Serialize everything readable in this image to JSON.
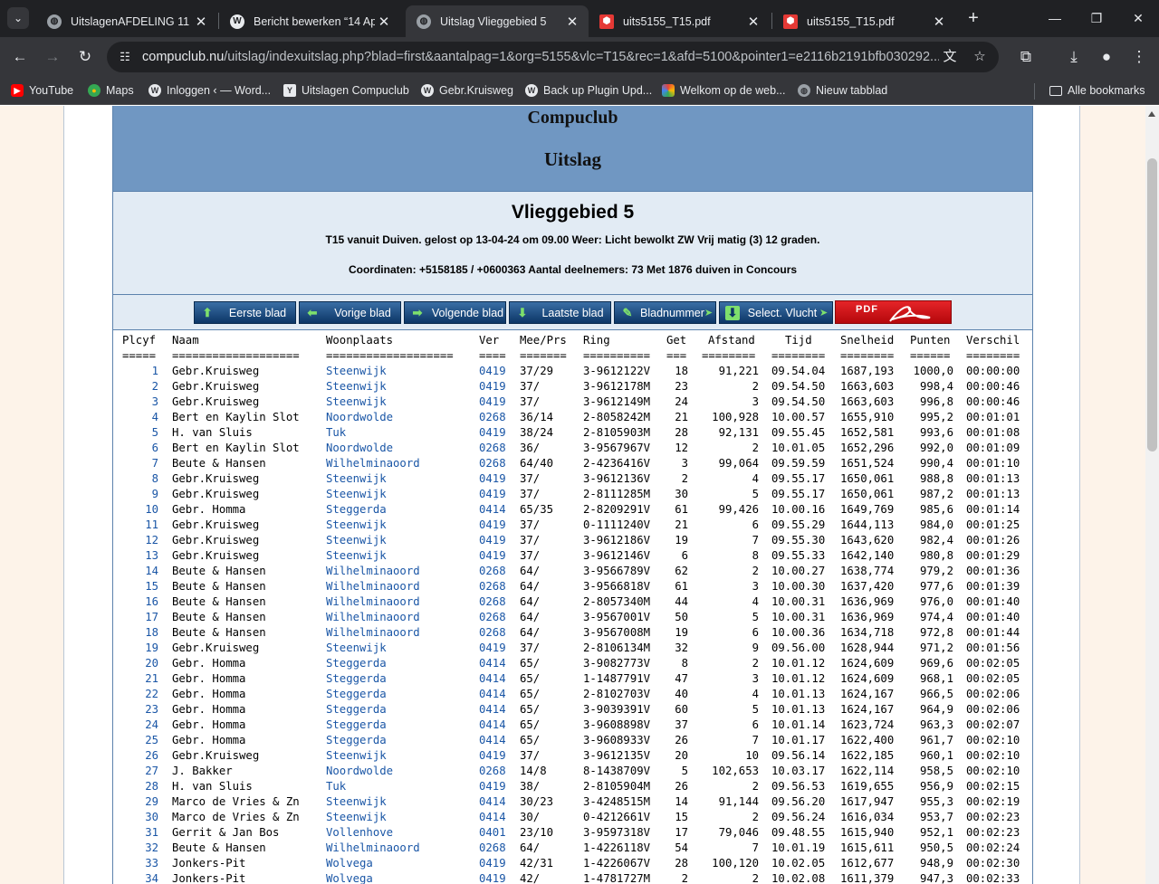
{
  "browser": {
    "tabs": [
      {
        "title": "UitslagenAFDELING 11",
        "icon": "globe-icon",
        "active": false
      },
      {
        "title": "Bericht bewerken “14 Ap",
        "icon": "wordpress-icon",
        "active": false
      },
      {
        "title": "Uitslag Vlieggebied 5",
        "icon": "globe-icon",
        "active": true
      },
      {
        "title": "uits5155_T15.pdf",
        "icon": "pdf-icon",
        "active": false
      },
      {
        "title": "uits5155_T15.pdf",
        "icon": "pdf-icon",
        "active": false
      }
    ],
    "url_host": "compuclub.nu",
    "url_rest": "/uitslag/indexuitslag.php?blad=first&aantalpag=1&org=5155&vlc=T15&rec=1&afd=5100&pointer1=e2116b2191bfb030292...",
    "bookmarks": [
      {
        "label": "YouTube",
        "icon": "youtube-icon"
      },
      {
        "label": "Maps",
        "icon": "maps-icon"
      },
      {
        "label": "Inloggen ‹ — Word...",
        "icon": "wordpress-icon"
      },
      {
        "label": "Uitslagen Compuclub",
        "icon": "compuclub-icon"
      },
      {
        "label": "Gebr.Kruisweg",
        "icon": "wordpress-icon"
      },
      {
        "label": "Back up Plugin Upd...",
        "icon": "wordpress-icon"
      },
      {
        "label": "Welkom op de web...",
        "icon": "colorful-icon"
      },
      {
        "label": "Nieuw tabblad",
        "icon": "globe-icon"
      }
    ],
    "all_bookmarks": "Alle bookmarks"
  },
  "header": {
    "club": "Compuclub",
    "title": "Uitslag"
  },
  "info": {
    "vlieggebied": "Vlieggebied 5",
    "line1": "T15 vanuit Duiven. gelost op 13-04-24 om 09.00 Weer: Licht bewolkt ZW Vrij matig (3) 12 graden.",
    "line2": "Coordinaten: +5158185 / +0600363 Aantal deelnemers: 73 Met 1876 duiven in Concours"
  },
  "nav_buttons": {
    "first": "Eerste blad",
    "prev": "Vorige blad",
    "next": "Volgende blad",
    "last": "Laatste blad",
    "page": "Bladnummer",
    "select": "Select. Vlucht",
    "pdf": "PDF"
  },
  "table": {
    "headers": {
      "plcyf": "Plcyf",
      "naam": "Naam",
      "woonplaats": "Woonplaats",
      "ver": "Ver",
      "meeprs": "Mee/Prs",
      "ring": "Ring",
      "get": "Get",
      "afstand": "Afstand",
      "tijd": "Tijd",
      "snelheid": "Snelheid",
      "punten": "Punten",
      "verschil": "Verschil"
    },
    "separators": {
      "plcyf": "=====",
      "naam": "===================",
      "woonplaats": "===================",
      "ver": "====",
      "meeprs": "=======",
      "ring": "==========",
      "get": "===",
      "afstand": "========",
      "tijd": "========",
      "snelheid": "========",
      "punten": "======",
      "verschil": "========"
    },
    "rows": [
      [
        "1",
        "Gebr.Kruisweg",
        "Steenwijk",
        "0419",
        "37/29",
        "3-9612122V",
        "18",
        "91,221",
        "09.54.04",
        "1687,193",
        "1000,0",
        "00:00:00"
      ],
      [
        "2",
        "Gebr.Kruisweg",
        "Steenwijk",
        "0419",
        "37/",
        "3-9612178M",
        "23",
        "2",
        "09.54.50",
        "1663,603",
        "998,4",
        "00:00:46"
      ],
      [
        "3",
        "Gebr.Kruisweg",
        "Steenwijk",
        "0419",
        "37/",
        "3-9612149M",
        "24",
        "3",
        "09.54.50",
        "1663,603",
        "996,8",
        "00:00:46"
      ],
      [
        "4",
        "Bert en Kaylin Slot",
        "Noordwolde",
        "0268",
        "36/14",
        "2-8058242M",
        "21",
        "100,928",
        "10.00.57",
        "1655,910",
        "995,2",
        "00:01:01"
      ],
      [
        "5",
        "H. van Sluis",
        "Tuk",
        "0419",
        "38/24",
        "2-8105903M",
        "28",
        "92,131",
        "09.55.45",
        "1652,581",
        "993,6",
        "00:01:08"
      ],
      [
        "6",
        "Bert en Kaylin Slot",
        "Noordwolde",
        "0268",
        "36/",
        "3-9567967V",
        "12",
        "2",
        "10.01.05",
        "1652,296",
        "992,0",
        "00:01:09"
      ],
      [
        "7",
        "Beute & Hansen",
        "Wilhelminaoord",
        "0268",
        "64/40",
        "2-4236416V",
        "3",
        "99,064",
        "09.59.59",
        "1651,524",
        "990,4",
        "00:01:10"
      ],
      [
        "8",
        "Gebr.Kruisweg",
        "Steenwijk",
        "0419",
        "37/",
        "3-9612136V",
        "2",
        "4",
        "09.55.17",
        "1650,061",
        "988,8",
        "00:01:13"
      ],
      [
        "9",
        "Gebr.Kruisweg",
        "Steenwijk",
        "0419",
        "37/",
        "2-8111285M",
        "30",
        "5",
        "09.55.17",
        "1650,061",
        "987,2",
        "00:01:13"
      ],
      [
        "10",
        "Gebr. Homma",
        "Steggerda",
        "0414",
        "65/35",
        "2-8209291V",
        "61",
        "99,426",
        "10.00.16",
        "1649,769",
        "985,6",
        "00:01:14"
      ],
      [
        "11",
        "Gebr.Kruisweg",
        "Steenwijk",
        "0419",
        "37/",
        "0-1111240V",
        "21",
        "6",
        "09.55.29",
        "1644,113",
        "984,0",
        "00:01:25"
      ],
      [
        "12",
        "Gebr.Kruisweg",
        "Steenwijk",
        "0419",
        "37/",
        "3-9612186V",
        "19",
        "7",
        "09.55.30",
        "1643,620",
        "982,4",
        "00:01:26"
      ],
      [
        "13",
        "Gebr.Kruisweg",
        "Steenwijk",
        "0419",
        "37/",
        "3-9612146V",
        "6",
        "8",
        "09.55.33",
        "1642,140",
        "980,8",
        "00:01:29"
      ],
      [
        "14",
        "Beute & Hansen",
        "Wilhelminaoord",
        "0268",
        "64/",
        "3-9566789V",
        "62",
        "2",
        "10.00.27",
        "1638,774",
        "979,2",
        "00:01:36"
      ],
      [
        "15",
        "Beute & Hansen",
        "Wilhelminaoord",
        "0268",
        "64/",
        "3-9566818V",
        "61",
        "3",
        "10.00.30",
        "1637,420",
        "977,6",
        "00:01:39"
      ],
      [
        "16",
        "Beute & Hansen",
        "Wilhelminaoord",
        "0268",
        "64/",
        "2-8057340M",
        "44",
        "4",
        "10.00.31",
        "1636,969",
        "976,0",
        "00:01:40"
      ],
      [
        "17",
        "Beute & Hansen",
        "Wilhelminaoord",
        "0268",
        "64/",
        "3-9567001V",
        "50",
        "5",
        "10.00.31",
        "1636,969",
        "974,4",
        "00:01:40"
      ],
      [
        "18",
        "Beute & Hansen",
        "Wilhelminaoord",
        "0268",
        "64/",
        "3-9567008M",
        "19",
        "6",
        "10.00.36",
        "1634,718",
        "972,8",
        "00:01:44"
      ],
      [
        "19",
        "Gebr.Kruisweg",
        "Steenwijk",
        "0419",
        "37/",
        "2-8106134M",
        "32",
        "9",
        "09.56.00",
        "1628,944",
        "971,2",
        "00:01:56"
      ],
      [
        "20",
        "Gebr. Homma",
        "Steggerda",
        "0414",
        "65/",
        "3-9082773V",
        "8",
        "2",
        "10.01.12",
        "1624,609",
        "969,6",
        "00:02:05"
      ],
      [
        "21",
        "Gebr. Homma",
        "Steggerda",
        "0414",
        "65/",
        "1-1487791V",
        "47",
        "3",
        "10.01.12",
        "1624,609",
        "968,1",
        "00:02:05"
      ],
      [
        "22",
        "Gebr. Homma",
        "Steggerda",
        "0414",
        "65/",
        "2-8102703V",
        "40",
        "4",
        "10.01.13",
        "1624,167",
        "966,5",
        "00:02:06"
      ],
      [
        "23",
        "Gebr. Homma",
        "Steggerda",
        "0414",
        "65/",
        "3-9039391V",
        "60",
        "5",
        "10.01.13",
        "1624,167",
        "964,9",
        "00:02:06"
      ],
      [
        "24",
        "Gebr. Homma",
        "Steggerda",
        "0414",
        "65/",
        "3-9608898V",
        "37",
        "6",
        "10.01.14",
        "1623,724",
        "963,3",
        "00:02:07"
      ],
      [
        "25",
        "Gebr. Homma",
        "Steggerda",
        "0414",
        "65/",
        "3-9608933V",
        "26",
        "7",
        "10.01.17",
        "1622,400",
        "961,7",
        "00:02:10"
      ],
      [
        "26",
        "Gebr.Kruisweg",
        "Steenwijk",
        "0419",
        "37/",
        "3-9612135V",
        "20",
        "10",
        "09.56.14",
        "1622,185",
        "960,1",
        "00:02:10"
      ],
      [
        "27",
        "J. Bakker",
        "Noordwolde",
        "0268",
        "14/8",
        "8-1438709V",
        "5",
        "102,653",
        "10.03.17",
        "1622,114",
        "958,5",
        "00:02:10"
      ],
      [
        "28",
        "H. van Sluis",
        "Tuk",
        "0419",
        "38/",
        "2-8105904M",
        "26",
        "2",
        "09.56.53",
        "1619,655",
        "956,9",
        "00:02:15"
      ],
      [
        "29",
        "Marco de Vries & Zn",
        "Steenwijk",
        "0414",
        "30/23",
        "3-4248515M",
        "14",
        "91,144",
        "09.56.20",
        "1617,947",
        "955,3",
        "00:02:19"
      ],
      [
        "30",
        "Marco de Vries & Zn",
        "Steenwijk",
        "0414",
        "30/",
        "0-4212661V",
        "15",
        "2",
        "09.56.24",
        "1616,034",
        "953,7",
        "00:02:23"
      ],
      [
        "31",
        "Gerrit & Jan Bos",
        "Vollenhove",
        "0401",
        "23/10",
        "3-9597318V",
        "17",
        "79,046",
        "09.48.55",
        "1615,940",
        "952,1",
        "00:02:23"
      ],
      [
        "32",
        "Beute & Hansen",
        "Wilhelminaoord",
        "0268",
        "64/",
        "1-4226118V",
        "54",
        "7",
        "10.01.19",
        "1615,611",
        "950,5",
        "00:02:24"
      ],
      [
        "33",
        "Jonkers-Pit",
        "Wolvega",
        "0419",
        "42/31",
        "1-4226067V",
        "28",
        "100,120",
        "10.02.05",
        "1612,677",
        "948,9",
        "00:02:30"
      ],
      [
        "34",
        "Jonkers-Pit",
        "Wolvega",
        "0419",
        "42/",
        "1-4781727M",
        "2",
        "2",
        "10.02.08",
        "1611,379",
        "947,3",
        "00:02:33"
      ]
    ]
  },
  "colors": {
    "header_bg": "#7097c2",
    "info_bg": "#e2ebf4",
    "link_blue": "#1a56a6",
    "page_bg": "#fdf3e9"
  }
}
